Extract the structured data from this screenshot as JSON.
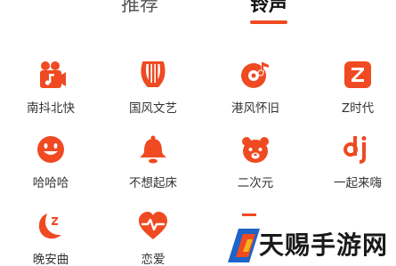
{
  "tabs": [
    {
      "label": "推荐",
      "active": false
    },
    {
      "label": "铃声",
      "active": true
    }
  ],
  "accent_color": "#ef4a22",
  "categories": [
    {
      "label": "南抖北快",
      "icon": "camera-music-icon"
    },
    {
      "label": "国风文艺",
      "icon": "lyre-icon"
    },
    {
      "label": "港风怀旧",
      "icon": "vinyl-record-icon"
    },
    {
      "label": "Z时代",
      "icon": "z-badge-icon"
    },
    {
      "label": "哈哈哈",
      "icon": "smiley-face-icon"
    },
    {
      "label": "不想起床",
      "icon": "bell-icon"
    },
    {
      "label": "二次元",
      "icon": "bear-face-icon"
    },
    {
      "label": "一起来嗨",
      "icon": "dj-icon"
    },
    {
      "label": "晚安曲",
      "icon": "moon-sleep-icon"
    },
    {
      "label": "恋爱",
      "icon": "heartbeat-icon"
    },
    {
      "label": "",
      "icon": "partial-icon"
    }
  ],
  "watermark": {
    "text": "天赐手游网"
  }
}
